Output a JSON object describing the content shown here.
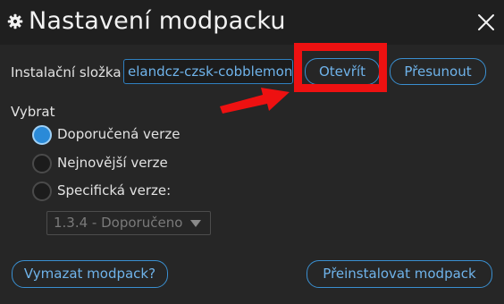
{
  "window": {
    "title": "Nastavení modpacku",
    "title_icon": "gear-icon",
    "close_icon": "close-icon"
  },
  "folder": {
    "label": "Instalační složka",
    "value": "elandcz-czsk-cobblemon",
    "open_label": "Otevřít",
    "move_label": "Přesunout"
  },
  "select_section": {
    "label": "Vybrat",
    "options": [
      {
        "label": "Doporučená verze",
        "checked": true
      },
      {
        "label": "Nejnovější verze",
        "checked": false
      },
      {
        "label": "Specifická verze:",
        "checked": false
      }
    ],
    "version_dropdown": {
      "selected": "1.3.4 - Doporučeno",
      "disabled": true
    }
  },
  "actions": {
    "delete_label": "Vymazat modpack?",
    "reinstall_label": "Přeinstalovat modpack"
  },
  "colors": {
    "background": "#262626",
    "accent": "#3a8fd0",
    "accent_text": "#6fb3ea",
    "annotation": "#ee1111"
  }
}
